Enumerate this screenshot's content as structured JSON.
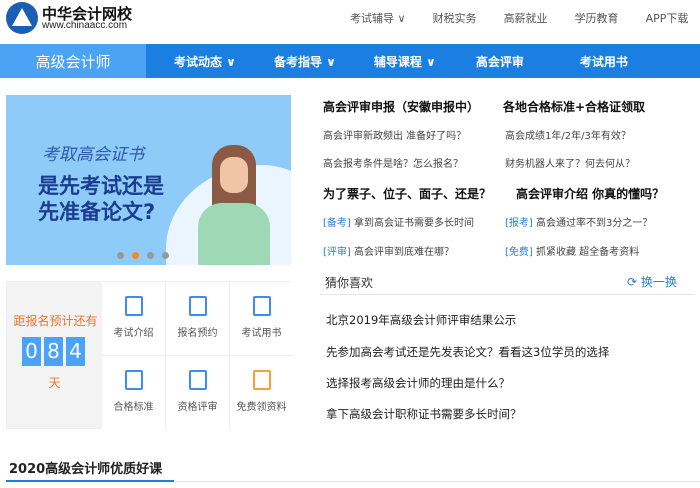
{
  "logo": {
    "name": "中华会计网校",
    "url": "www.chinaacc.com"
  },
  "top_links": [
    "考试辅导 ∨",
    "财税实务",
    "高薪就业",
    "学历教育",
    "APP下载"
  ],
  "nav": {
    "home": "高级会计师",
    "items": [
      "考试动态 ∨",
      "备考指导 ∨",
      "辅导课程 ∨",
      "高会评审",
      "考试用书"
    ]
  },
  "banner": {
    "line1": "考取高会证书",
    "line2": "是先考试还是",
    "line3": "先准备论文?",
    "active_slide": 2,
    "slides": 4
  },
  "countdown": {
    "title": "距报名预计还有",
    "digits": [
      "0",
      "8",
      "4"
    ],
    "unit": "天"
  },
  "quick_links": [
    "考试介绍",
    "报名预约",
    "考试用书",
    "合格标准",
    "资格评审",
    "免费领资料"
  ],
  "news": {
    "head1": "高会评审申报（安徽申报中）",
    "head2": "各地合格标准+合格证领取",
    "links1": [
      "高会评审新政频出 准备好了吗？",
      "高会成绩1年/2年/3年有效？",
      "高会报考条件是啥？怎么报名？",
      "财务机器人来了？何去何从？"
    ],
    "head3": "为了票子、位子、面子、还是？",
    "head4": "高会评审介绍 你真的懂吗？",
    "tagged": [
      {
        "tag": "[备考]",
        "text": "拿到高会证书需要多长时间"
      },
      {
        "tag": "[报考]",
        "text": "高会通过率不到3分之一？"
      },
      {
        "tag": "[评审]",
        "text": "高会评审到底难在哪？"
      },
      {
        "tag": "[免费]",
        "text": "抓紧收藏 超全备考资料"
      }
    ]
  },
  "guess": {
    "title": "猜你喜欢",
    "refresh": "换一换",
    "items": [
      "北京2019年高级会计师评审结果公示",
      "先参加高会考试还是先发表论文？看看这3位学员的选择",
      "选择报考高级会计师的理由是什么？",
      "拿下高级会计职称证书需要多长时间？"
    ]
  },
  "section_title": "2020高级会计师优质好课"
}
